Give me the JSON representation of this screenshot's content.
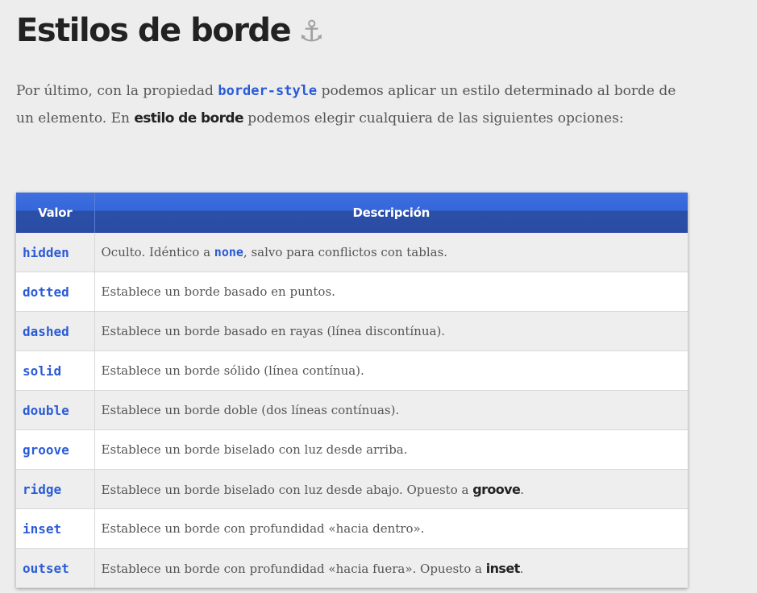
{
  "heading": {
    "title": "Estilos de borde",
    "anchor_icon": "⚓"
  },
  "intro": {
    "p1": "Por último, con la propiedad ",
    "code": "border-style",
    "p2": " podemos aplicar un estilo determinado al borde de un elemento. En ",
    "strong": "estilo de borde",
    "p3": " podemos elegir cualquiera de las siguientes opciones:"
  },
  "table": {
    "headers": [
      "Valor",
      "Descripción"
    ],
    "rows": [
      {
        "value": "hidden",
        "desc_before": "Oculto. Idéntico a ",
        "desc_code": "none",
        "desc_after": ", salvo para conflictos con tablas."
      },
      {
        "value": "dotted",
        "desc": "Establece un borde basado en puntos."
      },
      {
        "value": "dashed",
        "desc": "Establece un borde basado en rayas (línea discontínua)."
      },
      {
        "value": "solid",
        "desc": "Establece un borde sólido (línea contínua)."
      },
      {
        "value": "double",
        "desc": "Establece un borde doble (dos líneas contínuas)."
      },
      {
        "value": "groove",
        "desc": "Establece un borde biselado con luz desde arriba."
      },
      {
        "value": "ridge",
        "desc_before": "Establece un borde biselado con luz desde abajo. Opuesto a ",
        "desc_strong": "groove",
        "desc_after": "."
      },
      {
        "value": "inset",
        "desc": "Establece un borde con profundidad «hacia dentro»."
      },
      {
        "value": "outset",
        "desc_before": "Establece un borde con profundidad «hacia fuera». Opuesto a ",
        "desc_strong": "inset",
        "desc_after": "."
      }
    ]
  },
  "colors": {
    "page_bg": "#ededed",
    "header_bg": "#3566da",
    "code": "#2a5bd7",
    "text": "#555555",
    "heading": "#222222"
  }
}
